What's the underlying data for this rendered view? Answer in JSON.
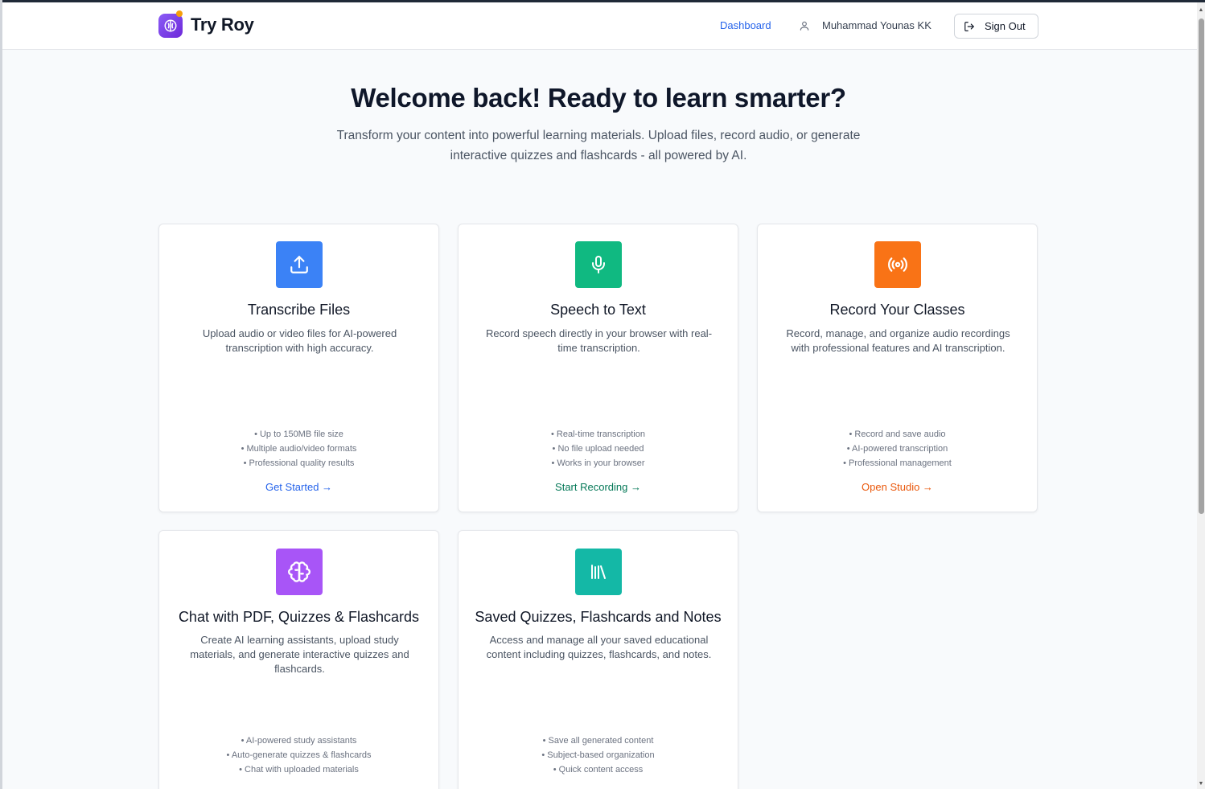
{
  "header": {
    "brand": "Try Roy",
    "nav_dashboard": "Dashboard",
    "user_name": "Muhammad Younas KK",
    "sign_out": "Sign Out"
  },
  "hero": {
    "title": "Welcome back! Ready to learn smarter?",
    "subtitle": "Transform your content into powerful learning materials. Upload files, record audio, or generate interactive quizzes and flashcards - all powered by AI."
  },
  "cards": [
    {
      "icon": "upload-icon",
      "color": "#3b82f6",
      "title": "Transcribe Files",
      "description": "Upload audio or video files for AI-powered transcription with high accuracy.",
      "features": [
        "• Up to 150MB file size",
        "• Multiple audio/video formats",
        "• Professional quality results"
      ],
      "cta": "Get Started →",
      "cta_color": "#2563eb"
    },
    {
      "icon": "microphone-icon",
      "color": "#10b981",
      "title": "Speech to Text",
      "description": "Record speech directly in your browser with real-time transcription.",
      "features": [
        "• Real-time transcription",
        "• No file upload needed",
        "• Works in your browser"
      ],
      "cta": "Start Recording →",
      "cta_color": "#059669"
    },
    {
      "icon": "broadcast-icon",
      "color": "#f97316",
      "title": "Record Your Classes",
      "description": "Record, manage, and organize audio recordings with professional features and AI transcription.",
      "features": [
        "• Record and save audio",
        "• AI-powered transcription",
        "• Professional management"
      ],
      "cta": "Open Studio →",
      "cta_color": "#ea580c"
    },
    {
      "icon": "brain-icon",
      "color": "#a855f7",
      "title": "Chat with PDF, Quizzes & Flashcards",
      "description": "Create AI learning assistants, upload study materials, and generate interactive quizzes and flashcards.",
      "features": [
        "• AI-powered study assistants",
        "• Auto-generate quizzes & flashcards",
        "• Chat with uploaded materials"
      ]
    },
    {
      "icon": "library-icon",
      "color": "#14b8a6",
      "title": "Saved Quizzes, Flashcards and Notes",
      "description": "Access and manage all your saved educational content including quizzes, flashcards, and notes.",
      "features": [
        "• Save all generated content",
        "• Subject-based organization",
        "• Quick content access"
      ]
    }
  ]
}
